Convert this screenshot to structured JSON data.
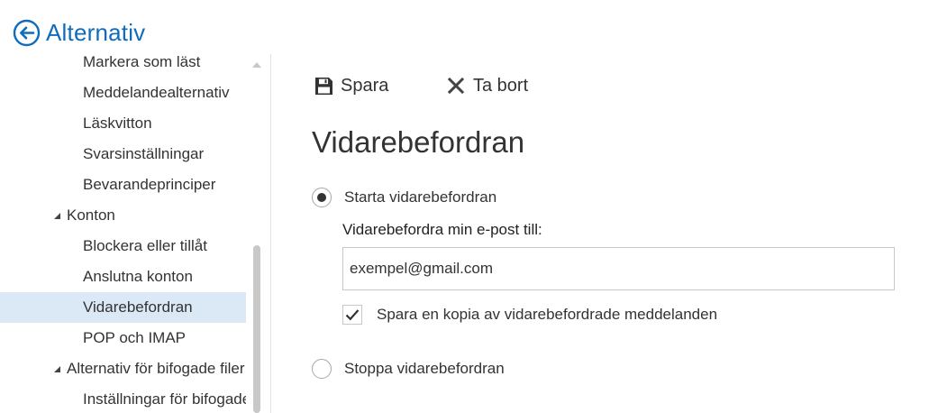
{
  "header": {
    "title": "Alternativ",
    "back_icon": "back-arrow-icon",
    "accent_color": "#0f6cbd"
  },
  "sidebar": {
    "items": [
      {
        "label": "Markera som läst",
        "level": 2
      },
      {
        "label": "Meddelandealternativ",
        "level": 2
      },
      {
        "label": "Läskvitton",
        "level": 2
      },
      {
        "label": "Svarsinställningar",
        "level": 2
      },
      {
        "label": "Bevarandeprinciper",
        "level": 2
      },
      {
        "label": "Konton",
        "level": 1,
        "expanded": true
      },
      {
        "label": "Blockera eller tillåt",
        "level": 2
      },
      {
        "label": "Anslutna konton",
        "level": 2
      },
      {
        "label": "Vidarebefordran",
        "level": 2,
        "selected": true
      },
      {
        "label": "POP och IMAP",
        "level": 2
      },
      {
        "label": "Alternativ för bifogade filer",
        "level": 1,
        "expanded": true
      },
      {
        "label": "Inställningar för bifogade filer",
        "level": 2
      }
    ],
    "selected_color": "#dbe8f6"
  },
  "toolbar": {
    "save_label": "Spara",
    "save_icon": "floppy-disk-icon",
    "delete_label": "Ta bort",
    "delete_icon": "x-icon"
  },
  "main": {
    "title": "Vidarebefordran",
    "start_option": {
      "label": "Starta vidarebefordran",
      "checked": true
    },
    "forward_label": "Vidarebefordra min e-post till:",
    "forward_value": "exempel@gmail.com",
    "keep_copy": {
      "label": "Spara en kopia av vidarebefordrade meddelanden",
      "checked": true
    },
    "stop_option": {
      "label": "Stoppa vidarebefordran",
      "checked": false
    }
  }
}
